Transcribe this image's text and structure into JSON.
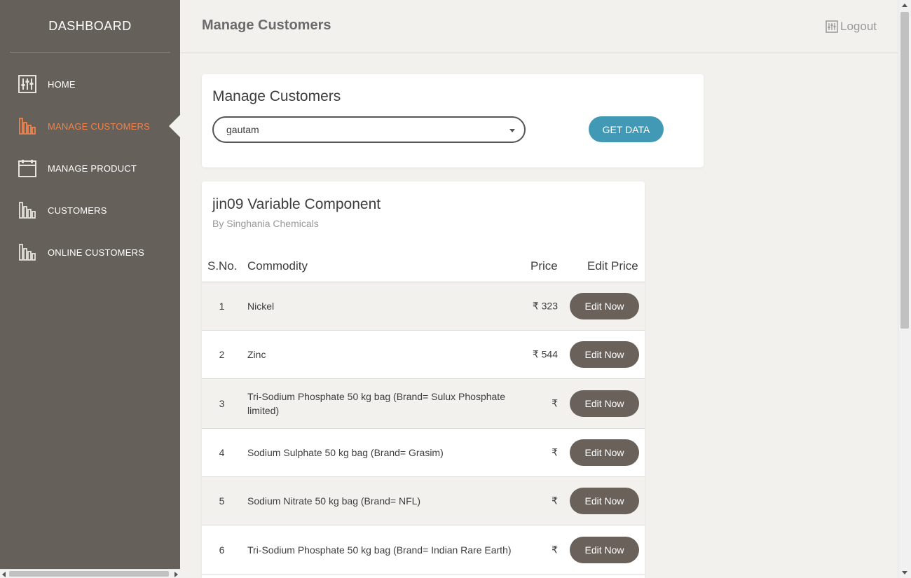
{
  "sidebar": {
    "brand": "DASHBOARD",
    "items": [
      {
        "label": "HOME",
        "icon": "sliders-icon",
        "active": false
      },
      {
        "label": "MANAGE CUSTOMERS",
        "icon": "bar-chart-icon",
        "active": true
      },
      {
        "label": "MANAGE PRODUCT",
        "icon": "calendar-icon",
        "active": false
      },
      {
        "label": "CUSTOMERS",
        "icon": "bar-chart-icon",
        "active": false
      },
      {
        "label": "ONLINE CUSTOMERS",
        "icon": "bar-chart-icon",
        "active": false
      }
    ]
  },
  "header": {
    "title": "Manage Customers",
    "logout_label": "Logout",
    "logout_icon": "sliders-icon"
  },
  "manage_card": {
    "title": "Manage Customers",
    "selected_customer": "gautam",
    "get_data_label": "GET DATA"
  },
  "component": {
    "title": "jin09 Variable Component",
    "subtitle": "By Singhania Chemicals",
    "columns": {
      "sno": "S.No.",
      "commodity": "Commodity",
      "price": "Price",
      "edit": "Edit Price"
    },
    "rows": [
      {
        "sno": "1",
        "commodity": "Nickel",
        "price": "₹ 323",
        "edit_label": "Edit Now"
      },
      {
        "sno": "2",
        "commodity": "Zinc",
        "price": "₹ 544",
        "edit_label": "Edit Now"
      },
      {
        "sno": "3",
        "commodity": "Tri-Sodium Phosphate 50 kg bag (Brand= Sulux Phosphate limited)",
        "price": "₹",
        "edit_label": "Edit Now"
      },
      {
        "sno": "4",
        "commodity": "Sodium Sulphate 50 kg bag (Brand= Grasim)",
        "price": "₹",
        "edit_label": "Edit Now"
      },
      {
        "sno": "5",
        "commodity": "Sodium Nitrate 50 kg bag (Brand= NFL)",
        "price": "₹",
        "edit_label": "Edit Now"
      },
      {
        "sno": "6",
        "commodity": "Tri-Sodium Phosphate 50 kg bag (Brand= Indian Rare Earth)",
        "price": "₹",
        "edit_label": "Edit Now"
      }
    ]
  },
  "colors": {
    "sidebar_bg": "#65605a",
    "active_accent": "#f0834d",
    "primary_button": "#4199b6",
    "edit_button": "#6a625a"
  }
}
